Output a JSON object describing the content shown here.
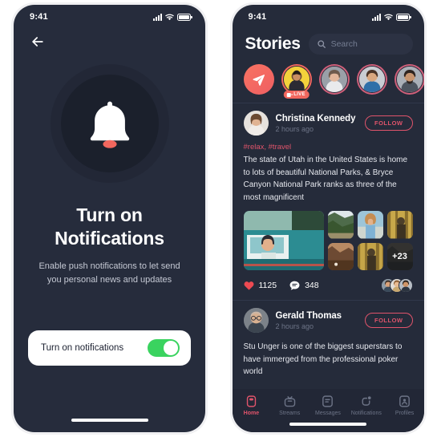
{
  "theme": {
    "bg_dark": "#252b3a",
    "bg_card": "#222736",
    "accent_pink": "#e0546b",
    "accent_orange": "#f2675e",
    "toggle_green": "#3ad35f",
    "text_muted": "#6d7487"
  },
  "left_screen": {
    "status": {
      "time": "9:41",
      "signal_icon": "signal-bars-icon",
      "wifi_icon": "wifi-icon",
      "battery_icon": "battery-icon"
    },
    "back_icon": "back-arrow-icon",
    "bell_icon": "bell-icon",
    "headline_line1": "Turn on",
    "headline_line2": "Notifications",
    "subtext": "Enable push notifications to let send you personal news and updates",
    "toggle": {
      "label": "Turn on notifications",
      "state": "on"
    }
  },
  "right_screen": {
    "status": {
      "time": "9:41",
      "signal_icon": "signal-bars-icon",
      "wifi_icon": "wifi-icon",
      "battery_icon": "battery-icon"
    },
    "title": "Stories",
    "search": {
      "placeholder": "Search",
      "icon": "search-icon",
      "value": ""
    },
    "stories": [
      {
        "type": "send",
        "icon": "send-icon",
        "label": ""
      },
      {
        "type": "avatar",
        "label": "",
        "badge": "LIVE",
        "badge_icon": "video-camera-icon"
      },
      {
        "type": "avatar",
        "label": ""
      },
      {
        "type": "avatar",
        "label": ""
      },
      {
        "type": "avatar",
        "label": ""
      }
    ],
    "posts": [
      {
        "author": "Christina Kennedy",
        "time": "2 hours ago",
        "follow_label": "FOLLOW",
        "tags": "#relax, #travel",
        "body": "The state of Utah in the United States is home to lots of beautiful National Parks, & Bryce Canyon National Park ranks as three of the most magnificent",
        "gallery_more": "+23",
        "likes": "1125",
        "comments": "348",
        "like_icon": "heart-icon",
        "comment_icon": "comment-bubble-icon"
      },
      {
        "author": "Gerald Thomas",
        "time": "2 hours ago",
        "follow_label": "FOLLOW",
        "body": "Stu Unger is one of the biggest superstars to have immerged from the professional poker world"
      }
    ],
    "tabs": [
      {
        "label": "Home",
        "icon": "home-icon",
        "active": true,
        "badge": false
      },
      {
        "label": "Streams",
        "icon": "tv-streams-icon",
        "active": false,
        "badge": false
      },
      {
        "label": "Messages",
        "icon": "message-icon",
        "active": false,
        "badge": false
      },
      {
        "label": "Notifications",
        "icon": "bell-notification-icon",
        "active": false,
        "badge": true
      },
      {
        "label": "Profiles",
        "icon": "profile-icon",
        "active": false,
        "badge": false
      }
    ]
  }
}
